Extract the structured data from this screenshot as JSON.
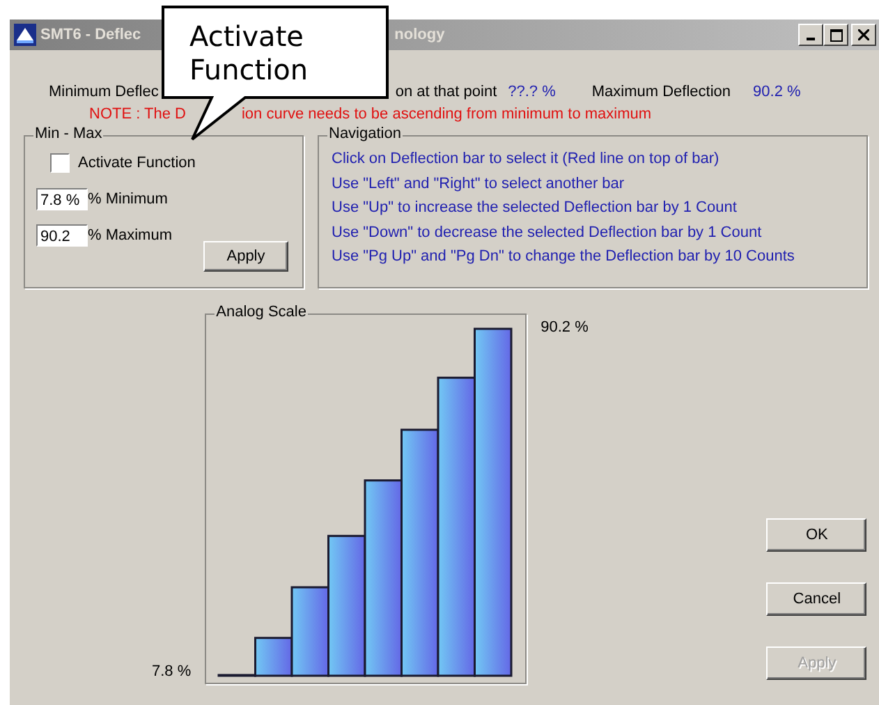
{
  "window": {
    "title_fragments": [
      "SMT6 - Deflec",
      "nology"
    ]
  },
  "callout": {
    "text": "Activate Function"
  },
  "header": {
    "min_fragment": "Minimum Deflec",
    "point_fragment": "on at that point",
    "point_value": "??.? %",
    "max_label": "Maximum Deflection",
    "max_value": "90.2 %",
    "note_fragments": [
      "NOTE : The D",
      "ion curve needs to be ascending from minimum to maximum"
    ]
  },
  "min_max": {
    "title": "Min - Max",
    "activate": {
      "label": "Activate Function",
      "checked": false
    },
    "fields": [
      {
        "value": "7.8 %",
        "label": "% Minimum"
      },
      {
        "value": "90.2",
        "label": "% Maximum"
      }
    ],
    "apply": {
      "label": "Apply",
      "disabled": false
    }
  },
  "navigation": {
    "title": "Navigation",
    "lines": [
      "Click on Deflection bar to select it (Red line on top of bar)",
      "Use \"Left\" and \"Right\" to select another bar",
      "Use \"Up\" to increase the  selected Deflection bar by 1 Count",
      "Use \"Down\" to decrease the selected Deflection bar by 1 Count",
      "Use \"Pg Up\" and \"Pg Dn\" to change the Deflection bar by 10 Counts"
    ]
  },
  "analog_scale": {
    "title": "Analog Scale",
    "min_label": "7.8 %",
    "max_label": "90.2 %"
  },
  "buttons": [
    {
      "label": "OK",
      "disabled": false
    },
    {
      "label": "Cancel",
      "disabled": false
    },
    {
      "label": "Apply",
      "disabled": true
    }
  ]
}
